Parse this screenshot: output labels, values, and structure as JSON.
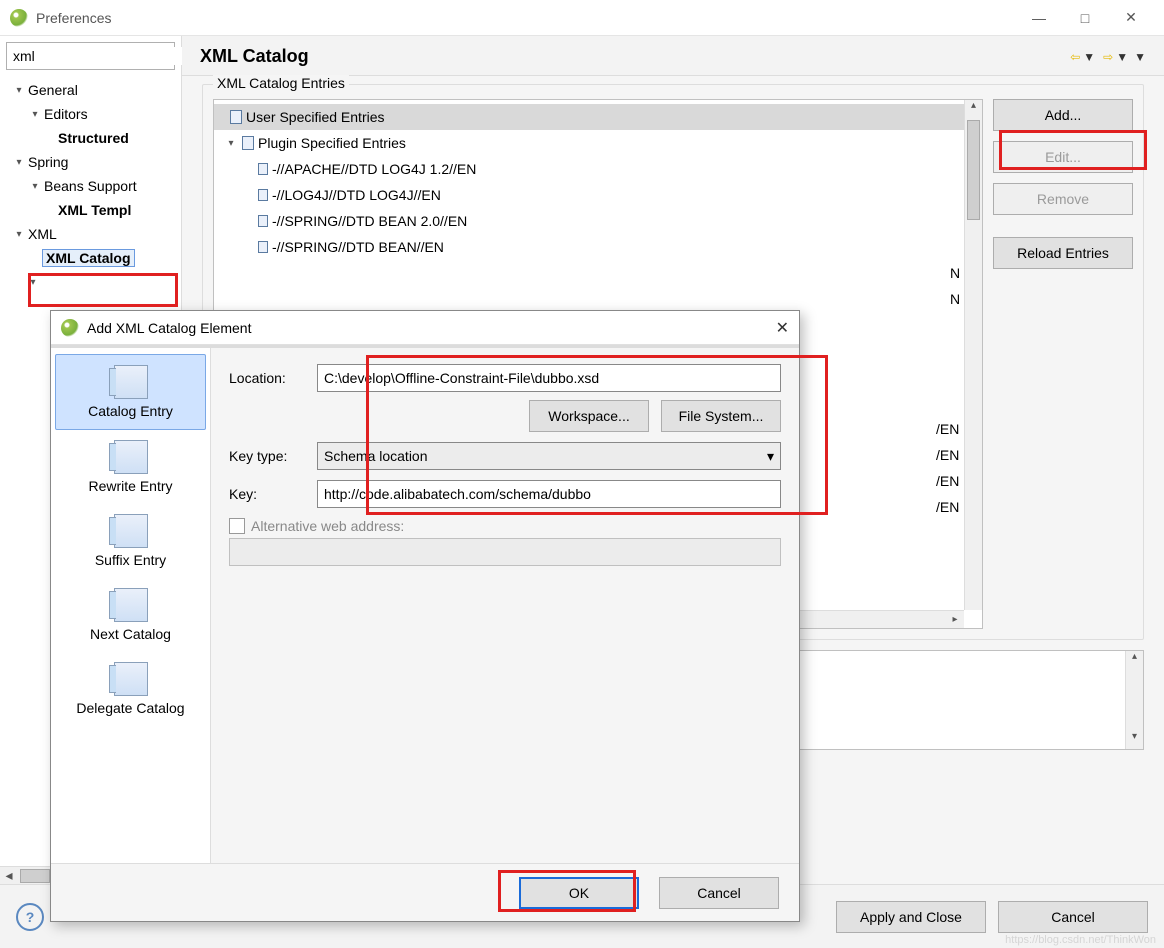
{
  "window": {
    "title": "Preferences"
  },
  "controls": {
    "min": "—",
    "max": "□",
    "close": "✕"
  },
  "search": {
    "value": "xml",
    "clear_glyph": "✕"
  },
  "tree": {
    "general": "General",
    "editors": "Editors",
    "structured": "Structured ",
    "spring": "Spring",
    "beans": "Beans Support",
    "xmltempl": "XML Templ",
    "xml": "XML",
    "xmlcatalog": "XML Catalog"
  },
  "header": {
    "title": "XML Catalog"
  },
  "group": {
    "title": "XML Catalog Entries"
  },
  "entries": {
    "user": "User Specified Entries",
    "plugin": "Plugin Specified Entries",
    "items": [
      "-//APACHE//DTD LOG4J 1.2//EN",
      "-//LOG4J//DTD LOG4J//EN",
      "-//SPRING//DTD BEAN 2.0//EN",
      "-//SPRING//DTD BEAN//EN"
    ],
    "peek": [
      "N",
      "N",
      "/EN",
      "/EN",
      "/EN",
      "/EN"
    ]
  },
  "buttons": {
    "add": "Add...",
    "edit": "Edit...",
    "remove": "Remove",
    "reload": "Reload Entries"
  },
  "footer": {
    "apply": "Apply and Close",
    "cancel": "Cancel",
    "help": "?"
  },
  "dialog": {
    "title": "Add XML Catalog Element",
    "side": {
      "catalog": "Catalog Entry",
      "rewrite": "Rewrite Entry",
      "suffix": "Suffix Entry",
      "next": "Next Catalog",
      "delegate": "Delegate Catalog"
    },
    "form": {
      "location_label": "Location:",
      "location_value": "C:\\develop\\Offline-Constraint-File\\dubbo.xsd",
      "workspace": "Workspace...",
      "filesystem": "File System...",
      "keytype_label": "Key type:",
      "keytype_value": "Schema location",
      "key_label": "Key:",
      "key_value": "http://code.alibabatech.com/schema/dubbo",
      "alt_label": "Alternative web address:"
    },
    "footer": {
      "ok": "OK",
      "cancel": "Cancel"
    }
  },
  "watermark": "https://blog.csdn.net/ThinkWon"
}
